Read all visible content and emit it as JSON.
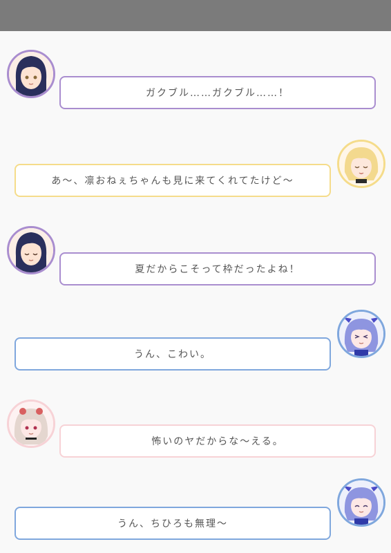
{
  "colors": {
    "topbar": "#7b7b7b",
    "background": "#f9f9f9",
    "purple": "#a98dcf",
    "yellow": "#f5dc8a",
    "blue": "#7fa7dd",
    "pink": "#f7d2d6"
  },
  "messages": [
    {
      "side": "left",
      "avatar": "dark-haired-girl-avatar",
      "text": "ガクブル……ガクブル……！"
    },
    {
      "side": "right",
      "avatar": "blonde-girl-avatar",
      "text": "あ～、凛おねぇちゃんも見に来てくれてたけど～"
    },
    {
      "side": "left",
      "avatar": "dark-haired-girl-avatar",
      "text": "夏だからこそって枠だったよね！"
    },
    {
      "side": "right",
      "avatar": "blue-haired-girl-avatar",
      "text": "うん、こわい。"
    },
    {
      "side": "left",
      "avatar": "silver-haired-girl-avatar",
      "text": "怖いのヤだからな～える。"
    },
    {
      "side": "right",
      "avatar": "blue-haired-girl-avatar",
      "text": "うん、ちひろも無理～"
    }
  ]
}
